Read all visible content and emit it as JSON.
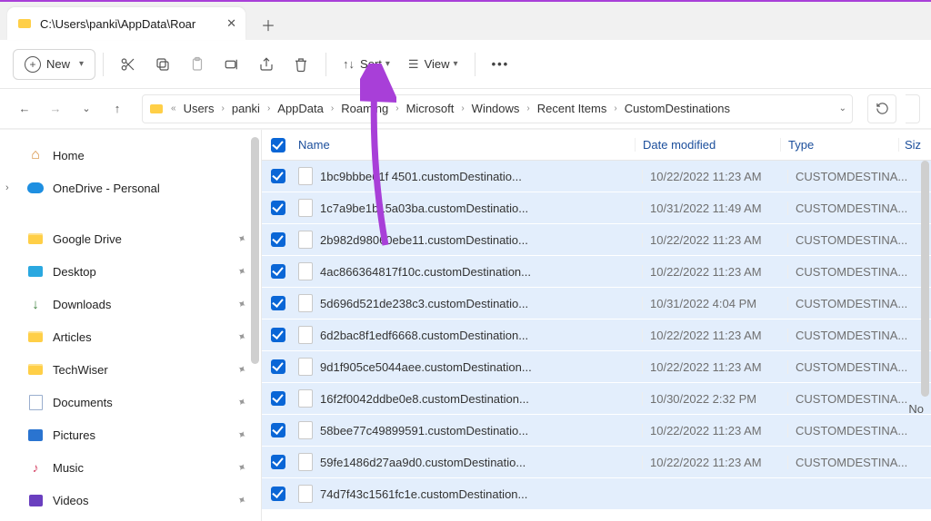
{
  "tab": {
    "title": "C:\\Users\\panki\\AppData\\Roar"
  },
  "toolbar": {
    "new_label": "New",
    "sort_label": "Sort",
    "view_label": "View"
  },
  "breadcrumb": {
    "segments": [
      "Users",
      "panki",
      "AppData",
      "Roaming",
      "Microsoft",
      "Windows",
      "Recent Items",
      "CustomDestinations"
    ]
  },
  "sidebar": {
    "home": "Home",
    "onedrive": "OneDrive - Personal",
    "items": [
      {
        "label": "Google Drive",
        "icon": "folder"
      },
      {
        "label": "Desktop",
        "icon": "desktop"
      },
      {
        "label": "Downloads",
        "icon": "down"
      },
      {
        "label": "Articles",
        "icon": "folder"
      },
      {
        "label": "TechWiser",
        "icon": "folder"
      },
      {
        "label": "Documents",
        "icon": "docs"
      },
      {
        "label": "Pictures",
        "icon": "pics"
      },
      {
        "label": "Music",
        "icon": "music"
      },
      {
        "label": "Videos",
        "icon": "video"
      }
    ]
  },
  "columns": {
    "name": "Name",
    "date": "Date modified",
    "type": "Type",
    "size": "Siz"
  },
  "rows": [
    {
      "name": "1bc9bbbe61f  4501.customDestinatio...",
      "date": "10/22/2022 11:23 AM",
      "type": "CUSTOMDESTINA..."
    },
    {
      "name": "1c7a9be1b15a03ba.customDestinatio...",
      "date": "10/31/2022 11:49 AM",
      "type": "CUSTOMDESTINA..."
    },
    {
      "name": "2b982d98060ebe11.customDestinatio...",
      "date": "10/22/2022 11:23 AM",
      "type": "CUSTOMDESTINA..."
    },
    {
      "name": "4ac866364817f10c.customDestination...",
      "date": "10/22/2022 11:23 AM",
      "type": "CUSTOMDESTINA..."
    },
    {
      "name": "5d696d521de238c3.customDestinatio...",
      "date": "10/31/2022 4:04 PM",
      "type": "CUSTOMDESTINA..."
    },
    {
      "name": "6d2bac8f1edf6668.customDestination...",
      "date": "10/22/2022 11:23 AM",
      "type": "CUSTOMDESTINA..."
    },
    {
      "name": "9d1f905ce5044aee.customDestination...",
      "date": "10/22/2022 11:23 AM",
      "type": "CUSTOMDESTINA..."
    },
    {
      "name": "16f2f0042ddbe0e8.customDestination...",
      "date": "10/30/2022 2:32 PM",
      "type": "CUSTOMDESTINA..."
    },
    {
      "name": "58bee77c49899591.customDestinatio...",
      "date": "10/22/2022 11:23 AM",
      "type": "CUSTOMDESTINA..."
    },
    {
      "name": "59fe1486d27aa9d0.customDestinatio...",
      "date": "10/22/2022 11:23 AM",
      "type": "CUSTOMDESTINA..."
    },
    {
      "name": "74d7f43c1561fc1e.customDestination...",
      "date": "",
      "type": ""
    }
  ],
  "note_right": "No"
}
